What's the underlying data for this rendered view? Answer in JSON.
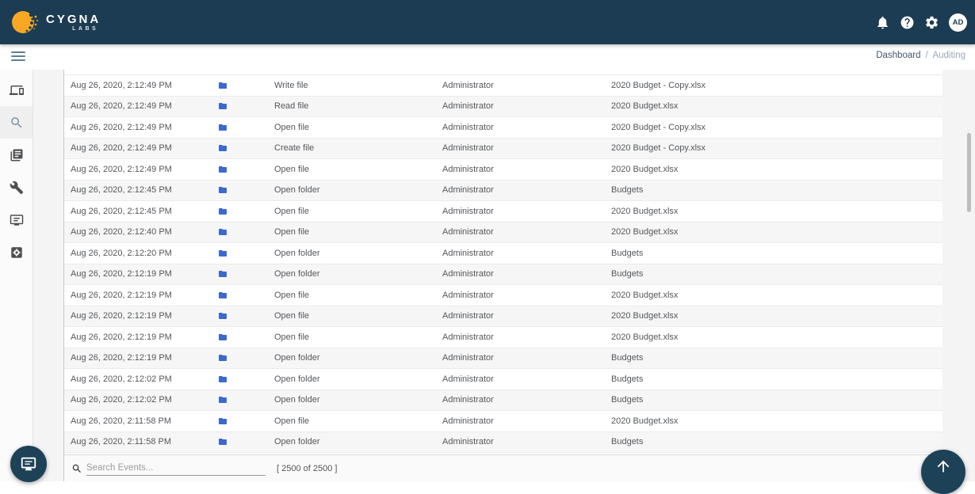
{
  "header": {
    "brand": "CYGNA",
    "brand_sub": "LABS",
    "avatar_initials": "AD",
    "icons": [
      {
        "name": "notifications-icon"
      },
      {
        "name": "help-icon"
      },
      {
        "name": "settings-icon"
      }
    ]
  },
  "breadcrumb": {
    "items": [
      "Dashboard",
      "Auditing"
    ],
    "separator": "/"
  },
  "sidebar": {
    "items": [
      {
        "name": "devices",
        "active": false
      },
      {
        "name": "search",
        "active": true
      },
      {
        "name": "reports",
        "active": false
      },
      {
        "name": "tools",
        "active": false
      },
      {
        "name": "console",
        "active": false
      },
      {
        "name": "settings-applications",
        "active": false
      }
    ]
  },
  "table": {
    "rows": [
      {
        "timestamp": "Aug 26, 2020, 2:12:49 PM",
        "icon": "folder",
        "action": "Write file",
        "user": "Administrator",
        "object": "2020 Budget - Copy.xlsx"
      },
      {
        "timestamp": "Aug 26, 2020, 2:12:49 PM",
        "icon": "folder",
        "action": "Read file",
        "user": "Administrator",
        "object": "2020 Budget.xlsx"
      },
      {
        "timestamp": "Aug 26, 2020, 2:12:49 PM",
        "icon": "folder",
        "action": "Open file",
        "user": "Administrator",
        "object": "2020 Budget - Copy.xlsx"
      },
      {
        "timestamp": "Aug 26, 2020, 2:12:49 PM",
        "icon": "folder",
        "action": "Create file",
        "user": "Administrator",
        "object": "2020 Budget - Copy.xlsx"
      },
      {
        "timestamp": "Aug 26, 2020, 2:12:49 PM",
        "icon": "folder",
        "action": "Open file",
        "user": "Administrator",
        "object": "2020 Budget.xlsx"
      },
      {
        "timestamp": "Aug 26, 2020, 2:12:45 PM",
        "icon": "folder",
        "action": "Open folder",
        "user": "Administrator",
        "object": "Budgets"
      },
      {
        "timestamp": "Aug 26, 2020, 2:12:45 PM",
        "icon": "folder",
        "action": "Open file",
        "user": "Administrator",
        "object": "2020 Budget.xlsx"
      },
      {
        "timestamp": "Aug 26, 2020, 2:12:40 PM",
        "icon": "folder",
        "action": "Open file",
        "user": "Administrator",
        "object": "2020 Budget.xlsx"
      },
      {
        "timestamp": "Aug 26, 2020, 2:12:20 PM",
        "icon": "folder",
        "action": "Open folder",
        "user": "Administrator",
        "object": "Budgets"
      },
      {
        "timestamp": "Aug 26, 2020, 2:12:19 PM",
        "icon": "folder",
        "action": "Open folder",
        "user": "Administrator",
        "object": "Budgets"
      },
      {
        "timestamp": "Aug 26, 2020, 2:12:19 PM",
        "icon": "folder",
        "action": "Open file",
        "user": "Administrator",
        "object": "2020 Budget.xlsx"
      },
      {
        "timestamp": "Aug 26, 2020, 2:12:19 PM",
        "icon": "folder",
        "action": "Open file",
        "user": "Administrator",
        "object": "2020 Budget.xlsx"
      },
      {
        "timestamp": "Aug 26, 2020, 2:12:19 PM",
        "icon": "folder",
        "action": "Open file",
        "user": "Administrator",
        "object": "2020 Budget.xlsx"
      },
      {
        "timestamp": "Aug 26, 2020, 2:12:19 PM",
        "icon": "folder",
        "action": "Open folder",
        "user": "Administrator",
        "object": "Budgets"
      },
      {
        "timestamp": "Aug 26, 2020, 2:12:02 PM",
        "icon": "folder",
        "action": "Open folder",
        "user": "Administrator",
        "object": "Budgets"
      },
      {
        "timestamp": "Aug 26, 2020, 2:12:02 PM",
        "icon": "folder",
        "action": "Open folder",
        "user": "Administrator",
        "object": "Budgets"
      },
      {
        "timestamp": "Aug 26, 2020, 2:11:58 PM",
        "icon": "folder",
        "action": "Open file",
        "user": "Administrator",
        "object": "2020 Budget.xlsx"
      },
      {
        "timestamp": "Aug 26, 2020, 2:11:58 PM",
        "icon": "folder",
        "action": "Open folder",
        "user": "Administrator",
        "object": "Budgets"
      }
    ]
  },
  "footer": {
    "search_placeholder": "Search Events...",
    "count_label": "[ 2500 of 2500 ]"
  },
  "colors": {
    "header_navy": "#1c3c53",
    "folder_blue": "#3c69cf",
    "logo_orange": "#f9a825",
    "active_sidebar_icon": "#7b93a7"
  }
}
